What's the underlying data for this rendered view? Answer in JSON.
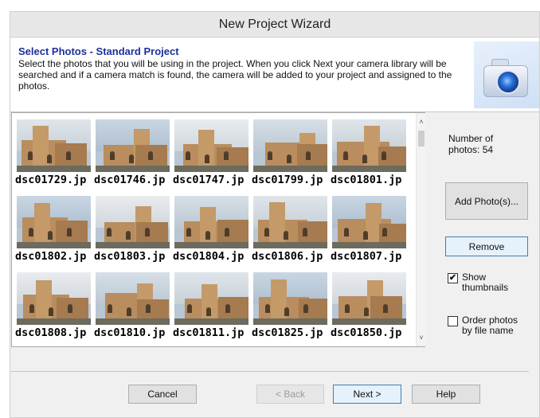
{
  "window": {
    "title": "New Project Wizard"
  },
  "header": {
    "title": "Select Photos - Standard Project",
    "description": "Select the photos that you will be using in the project. When you click Next your camera library will be searched and if a camera match is found, the camera will be added to your project and assigned to the photos."
  },
  "photos": [
    "dsc01729.jp",
    "dsc01746.jp",
    "dsc01747.jp",
    "dsc01799.jp",
    "dsc01801.jp",
    "dsc01802.jp",
    "dsc01803.jp",
    "dsc01804.jp",
    "dsc01806.jp",
    "dsc01807.jp",
    "dsc01808.jp",
    "dsc01810.jp",
    "dsc01811.jp",
    "dsc01825.jp",
    "dsc01850.jp"
  ],
  "side": {
    "count_label": "Number of photos: 54",
    "add_button": "Add Photo(s)...",
    "remove_button": "Remove",
    "show_thumbnails": {
      "label": "Show thumbnails",
      "checked": true,
      "mark": "✔"
    },
    "order_by_name": {
      "label": "Order photos by file name",
      "checked": false
    }
  },
  "footer": {
    "cancel": "Cancel",
    "back": "< Back",
    "next": "Next >",
    "help": "Help"
  },
  "icons": {
    "header": "camera-icon",
    "scroll_up": "chevron-up-icon",
    "scroll_down": "chevron-down-icon"
  },
  "colors": {
    "title_accent": "#1c2f9c",
    "focus_border": "#3c7fb1"
  }
}
